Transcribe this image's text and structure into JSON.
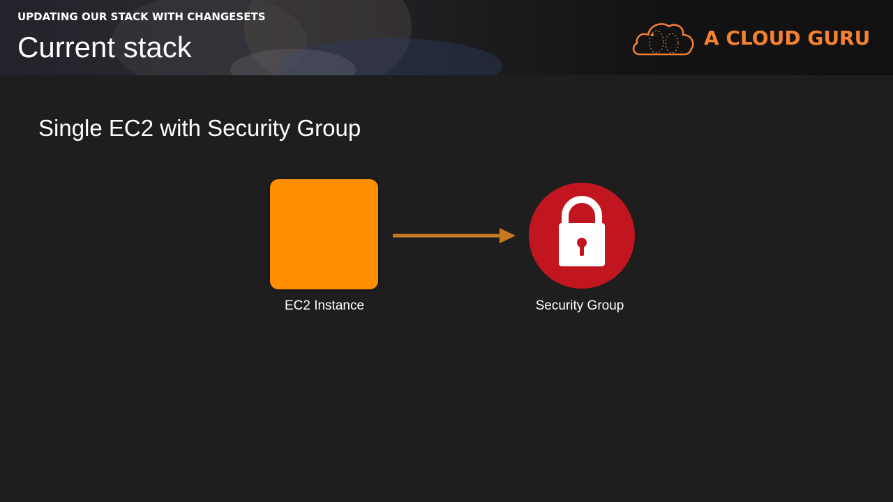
{
  "header": {
    "section_label": "UPDATING OUR STACK WITH CHANGESETS",
    "title": "Current stack",
    "brand_name": "A CLOUD GURU",
    "brand_logo_icon": "cloud-logo-icon",
    "brand_color": "#f58233"
  },
  "slide": {
    "subtitle": "Single EC2 with Security Group"
  },
  "diagram": {
    "nodes": [
      {
        "id": "ec2",
        "label": "EC2 Instance",
        "color": "#ff8f00",
        "shape": "rounded-square"
      },
      {
        "id": "security-group",
        "label": "Security Group",
        "color": "#c1151f",
        "shape": "circle",
        "icon": "padlock-icon"
      }
    ],
    "edges": [
      {
        "from": "ec2",
        "to": "security-group",
        "color": "#c77a1f",
        "style": "arrow"
      }
    ]
  }
}
